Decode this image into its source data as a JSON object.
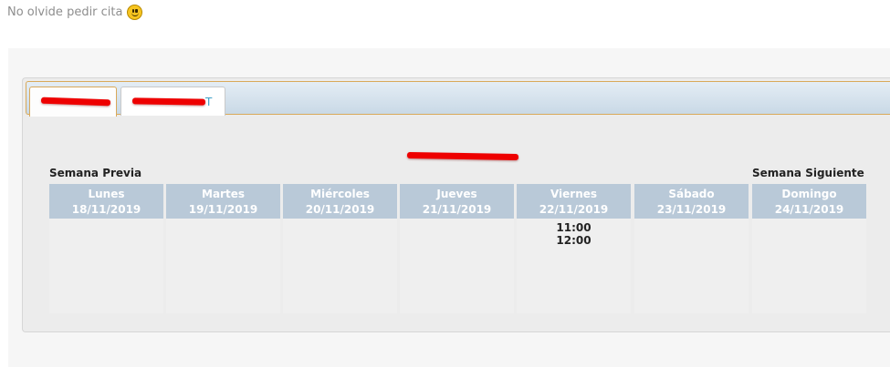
{
  "intro": {
    "text": "No olvide pedir cita",
    "emoji": "smiley-icon"
  },
  "tabs": [
    {
      "label": "",
      "redacted": true,
      "active": true
    },
    {
      "label": "T",
      "redacted": true,
      "active": false
    }
  ],
  "calendar": {
    "title": "",
    "prev_label": "Semana Previa",
    "next_label": "Semana Siguiente",
    "days": [
      {
        "name": "Lunes",
        "date": "18/11/2019",
        "slots": []
      },
      {
        "name": "Martes",
        "date": "19/11/2019",
        "slots": []
      },
      {
        "name": "Miércoles",
        "date": "20/11/2019",
        "slots": []
      },
      {
        "name": "Jueves",
        "date": "21/11/2019",
        "slots": []
      },
      {
        "name": "Viernes",
        "date": "22/11/2019",
        "slots": [
          "11:00",
          "12:00"
        ]
      },
      {
        "name": "Sábado",
        "date": "23/11/2019",
        "slots": []
      },
      {
        "name": "Domingo",
        "date": "24/11/2019",
        "slots": []
      }
    ]
  },
  "colors": {
    "header_bg": "#b9c9d8",
    "tab_text": "#3fa0c8",
    "tab_border_active": "#d9a95a",
    "redaction": "#ee0000"
  }
}
